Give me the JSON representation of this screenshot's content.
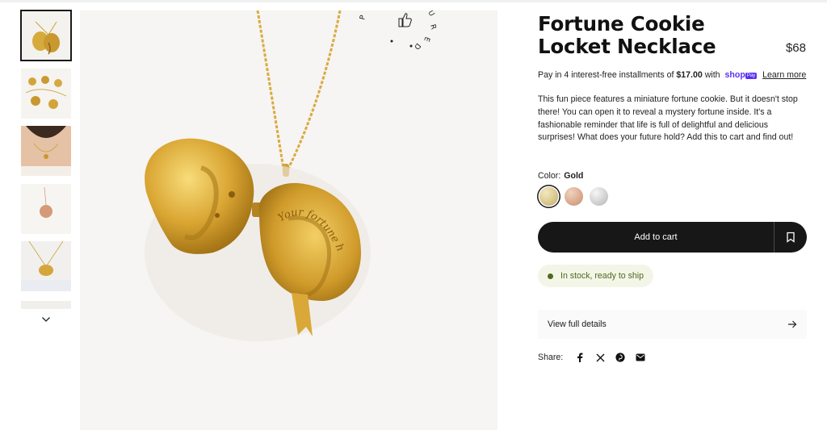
{
  "product": {
    "title": "Fortune Cookie Locket Necklace",
    "price": "$68",
    "installments": {
      "prefix": "Pay in 4 interest-free installments of",
      "amount": "$17.00",
      "middle": "with",
      "shop_pay": "shop",
      "shop_pay_badge": "Pay",
      "learn_more": "Learn more"
    },
    "description": "This fun piece features a miniature fortune cookie. But it doesn't stop there! You can open it to reveal a mystery fortune inside. It's a fashionable reminder that life is full of delightful and delicious surprises! What does your future hold? Add this to cart and find out!",
    "color_label": "Color:",
    "color_value": "Gold",
    "swatches": [
      "Gold",
      "Rose Gold",
      "Silver"
    ],
    "add_to_cart": "Add to cart",
    "stock_status": "In stock, ready to ship",
    "view_details": "View full details",
    "share_label": "Share:"
  },
  "image": {
    "engraving": "Your fortune here...",
    "badge_text": "P R O D U C T   F E A T U R E D"
  },
  "icons": {
    "chevron": "chevron-down-icon",
    "wishlist": "bookmark-icon",
    "arrow": "arrow-right-icon",
    "share": [
      "facebook-icon",
      "x-icon",
      "pinterest-icon",
      "email-icon"
    ]
  },
  "colors": {
    "accent": "#171717",
    "shop_pay": "#5a31f4",
    "stock": "#4f6b1e",
    "stock_bg": "#f3f6e7"
  }
}
